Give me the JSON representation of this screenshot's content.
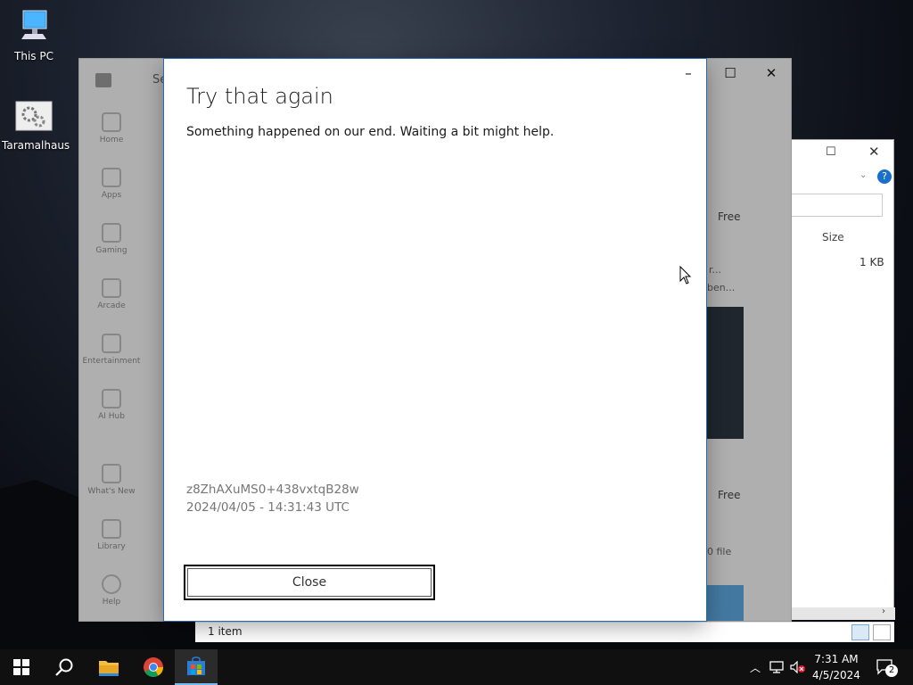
{
  "desktop": {
    "icons": [
      {
        "label": "This PC",
        "icon": "computer-icon"
      },
      {
        "label": "Taramalhaus",
        "icon": "settings-gears-icon"
      }
    ]
  },
  "store_sidebar": {
    "items": [
      "Home",
      "Apps",
      "Gaming",
      "Arcade",
      "Entertainment",
      "AI Hub",
      "What's New",
      "Library",
      "Help"
    ]
  },
  "store_background": {
    "search_partial": "Se",
    "free_label_1": "Free",
    "free_label_2": "Free",
    "partial_text_1": "r...",
    "partial_text_2": "ben...",
    "partial_text_3": "0 file"
  },
  "explorer": {
    "column_size": "Size",
    "file_size": "1 KB",
    "status_items": "1 item"
  },
  "dialog": {
    "title": "Try that again",
    "message": "Something happened on our end. Waiting a bit might help.",
    "code": "z8ZhAXuMS0+438vxtqB28w",
    "timestamp": "2024/04/05 - 14:31:43 UTC",
    "close_label": "Close"
  },
  "taskbar": {
    "time": "7:31 AM",
    "date": "4/5/2024",
    "notification_count": "2",
    "accent_color": "#76b9ed"
  }
}
